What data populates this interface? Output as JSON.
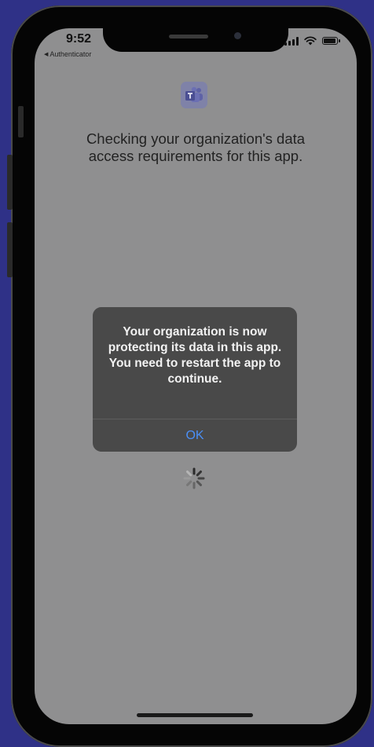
{
  "status_bar": {
    "time": "9:52",
    "back_app": "Authenticator",
    "icons": [
      "signal-icon",
      "wifi-icon",
      "battery-icon"
    ]
  },
  "app": {
    "logo_icon": "teams-logo-icon",
    "message": "Checking your organization's data access requirements for this app."
  },
  "alert": {
    "message": "Your organization is now protecting its data in this app. You need to restart the app to continue.",
    "ok_label": "OK"
  },
  "colors": {
    "background": "#2f3187",
    "screen": "#8f8f90",
    "alert": "#494949",
    "ok_blue": "#4a8ff7"
  },
  "loading": {
    "icon": "spinner-icon"
  }
}
